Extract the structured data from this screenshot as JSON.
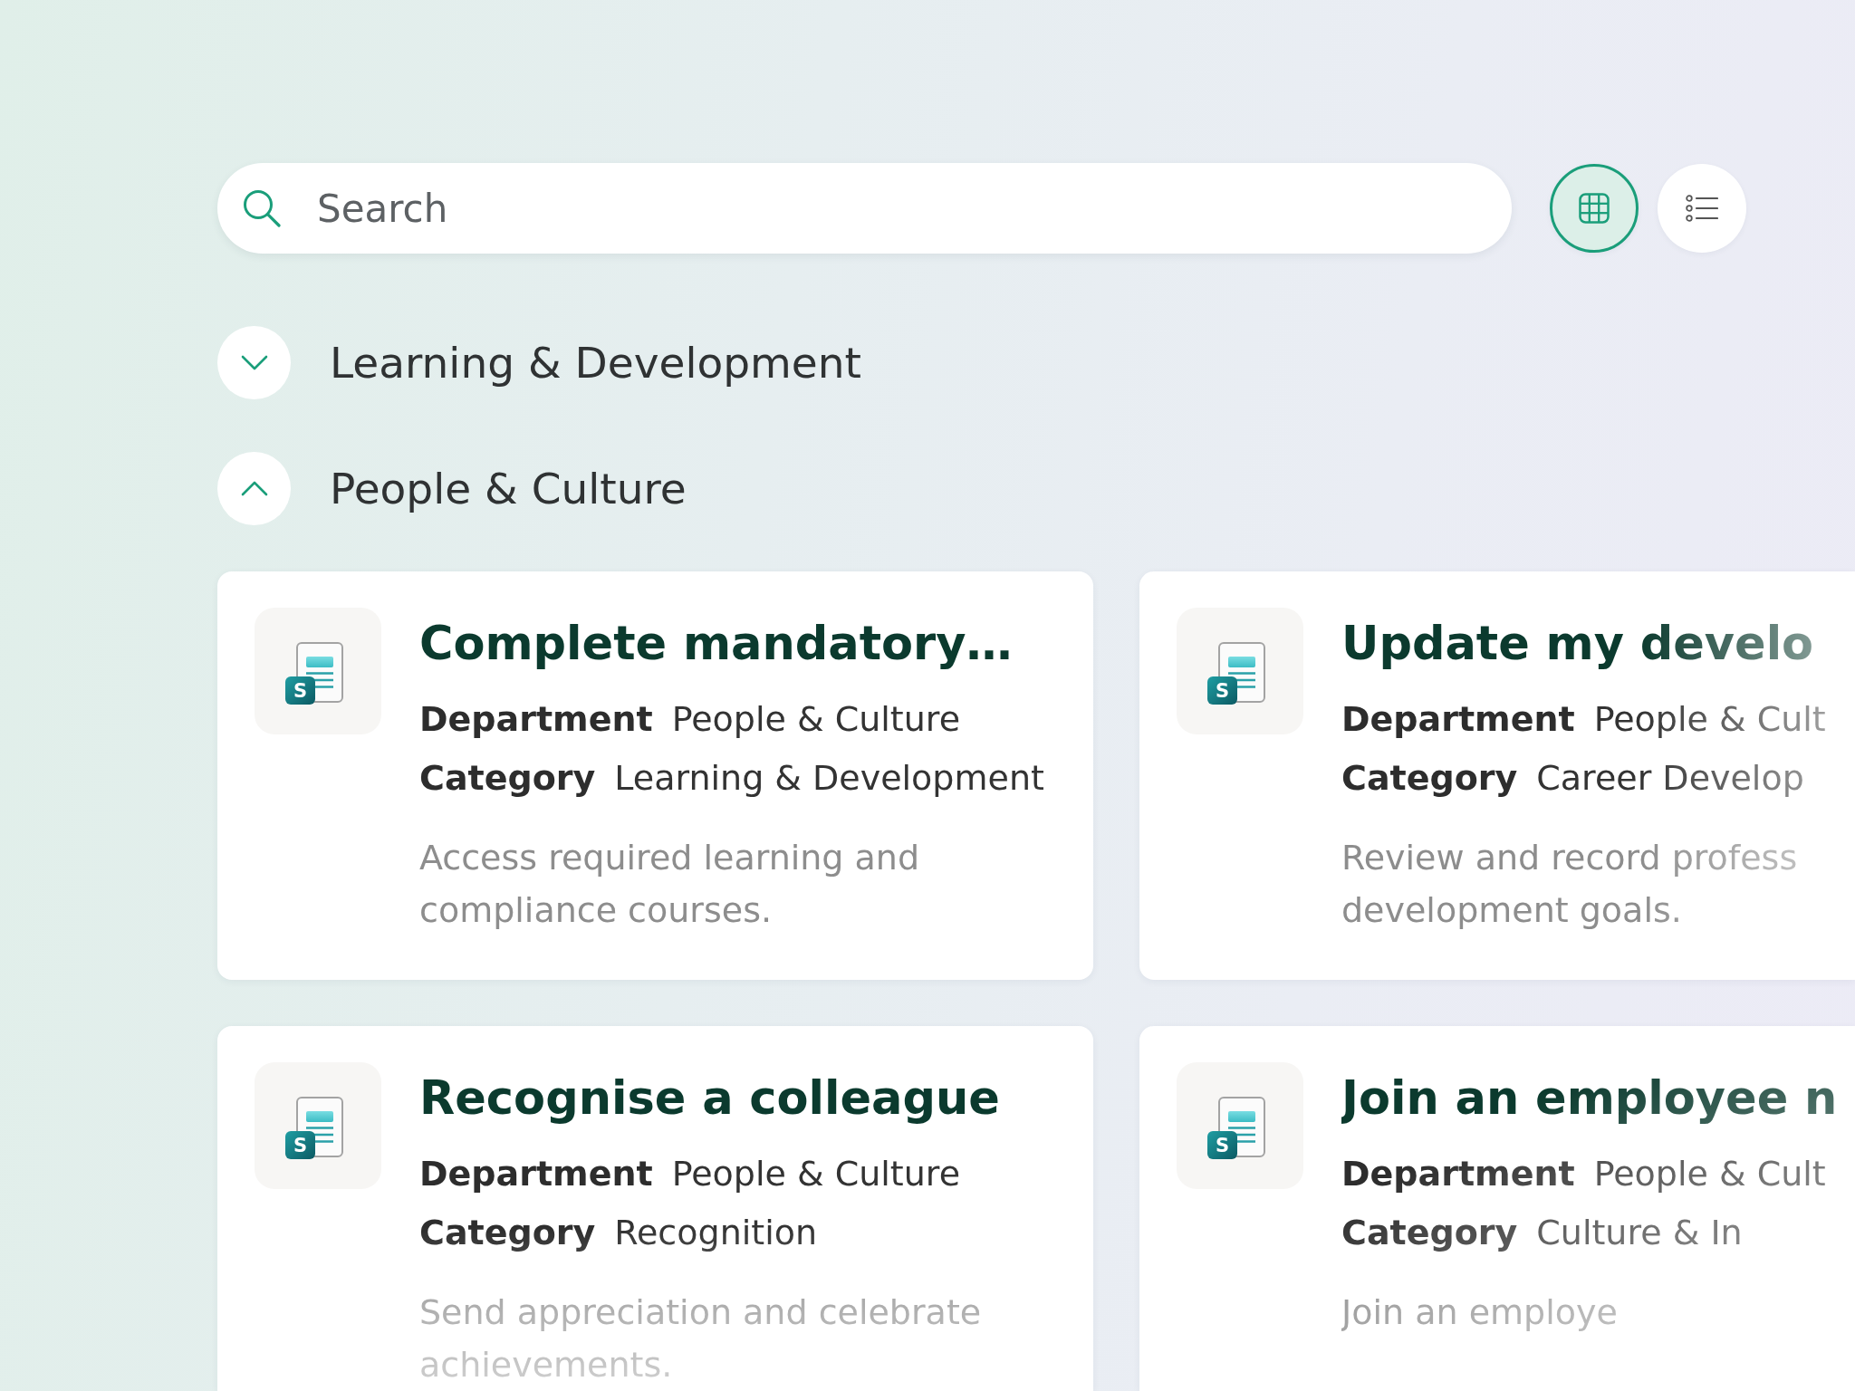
{
  "search": {
    "placeholder": "Search"
  },
  "view_buttons": [
    {
      "kind": "grid",
      "selected": true
    },
    {
      "kind": "list",
      "selected": false
    }
  ],
  "sections": [
    {
      "title": "Learning & Development",
      "expanded": false
    },
    {
      "title": "People & Culture",
      "expanded": true,
      "cards": [
        {
          "icon_letter": "S",
          "title": "Complete mandatory…",
          "department_label": "Department",
          "department": "People & Culture",
          "category_label": "Category",
          "category": "Learning & Development",
          "description": "Access required learning and compliance courses."
        },
        {
          "icon_letter": "S",
          "title": "Update my develo",
          "department_label": "Department",
          "department": "People & Cult",
          "category_label": "Category",
          "category": "Career Develop",
          "description": "Review and record profess development goals."
        },
        {
          "icon_letter": "S",
          "title": "Recognise a colleague",
          "department_label": "Department",
          "department": "People & Culture",
          "category_label": "Category",
          "category": "Recognition",
          "description": "Send appreciation and celebrate achievements."
        },
        {
          "icon_letter": "S",
          "title": "Join an employee n",
          "department_label": "Department",
          "department": "People & Cult",
          "category_label": "Category",
          "category": "Culture & In",
          "description": "Join an employe"
        }
      ]
    }
  ]
}
